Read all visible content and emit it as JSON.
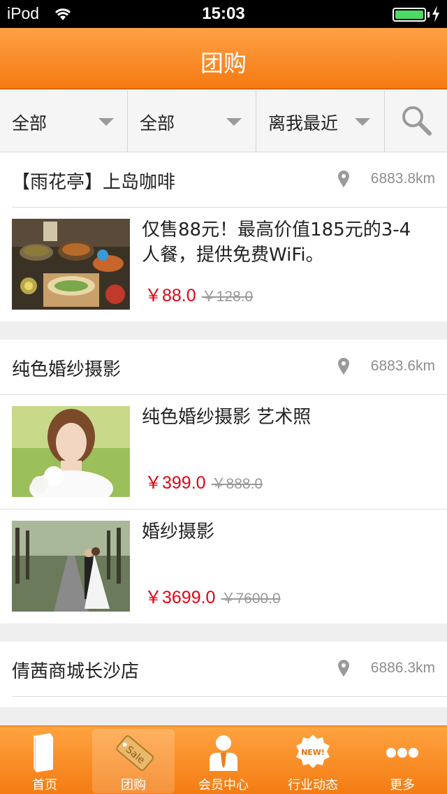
{
  "status_bar": {
    "carrier": "iPod",
    "time": "15:03"
  },
  "nav": {
    "title": "团购"
  },
  "filters": [
    {
      "label": "全部"
    },
    {
      "label": "全部"
    },
    {
      "label": "离我最近"
    }
  ],
  "shops": [
    {
      "name": "【雨花亭】上岛咖啡",
      "distance": "6883.8km",
      "deals": [
        {
          "title": "仅售88元！最高价值185元的3-4人餐，提供免费WiFi。",
          "price": "￥88.0",
          "original_price": "￥128.0"
        }
      ]
    },
    {
      "name": "纯色婚纱摄影",
      "distance": "6883.6km",
      "deals": [
        {
          "title": "纯色婚纱摄影 艺术照",
          "price": "￥399.0",
          "original_price": "￥888.0"
        },
        {
          "title": "婚纱摄影",
          "price": "￥3699.0",
          "original_price": "￥7600.0"
        }
      ]
    },
    {
      "name": "倩茜商城长沙店",
      "distance": "6886.3km",
      "deals": []
    }
  ],
  "tabs": [
    {
      "label": "首页",
      "icon": "book-icon"
    },
    {
      "label": "团购",
      "icon": "sale-tag-icon",
      "active": true
    },
    {
      "label": "会员中心",
      "icon": "member-icon"
    },
    {
      "label": "行业动态",
      "icon": "new-badge-icon"
    },
    {
      "label": "更多",
      "icon": "more-dots-icon"
    }
  ],
  "colors": {
    "accent": "#f57a12",
    "price": "#e60012"
  }
}
